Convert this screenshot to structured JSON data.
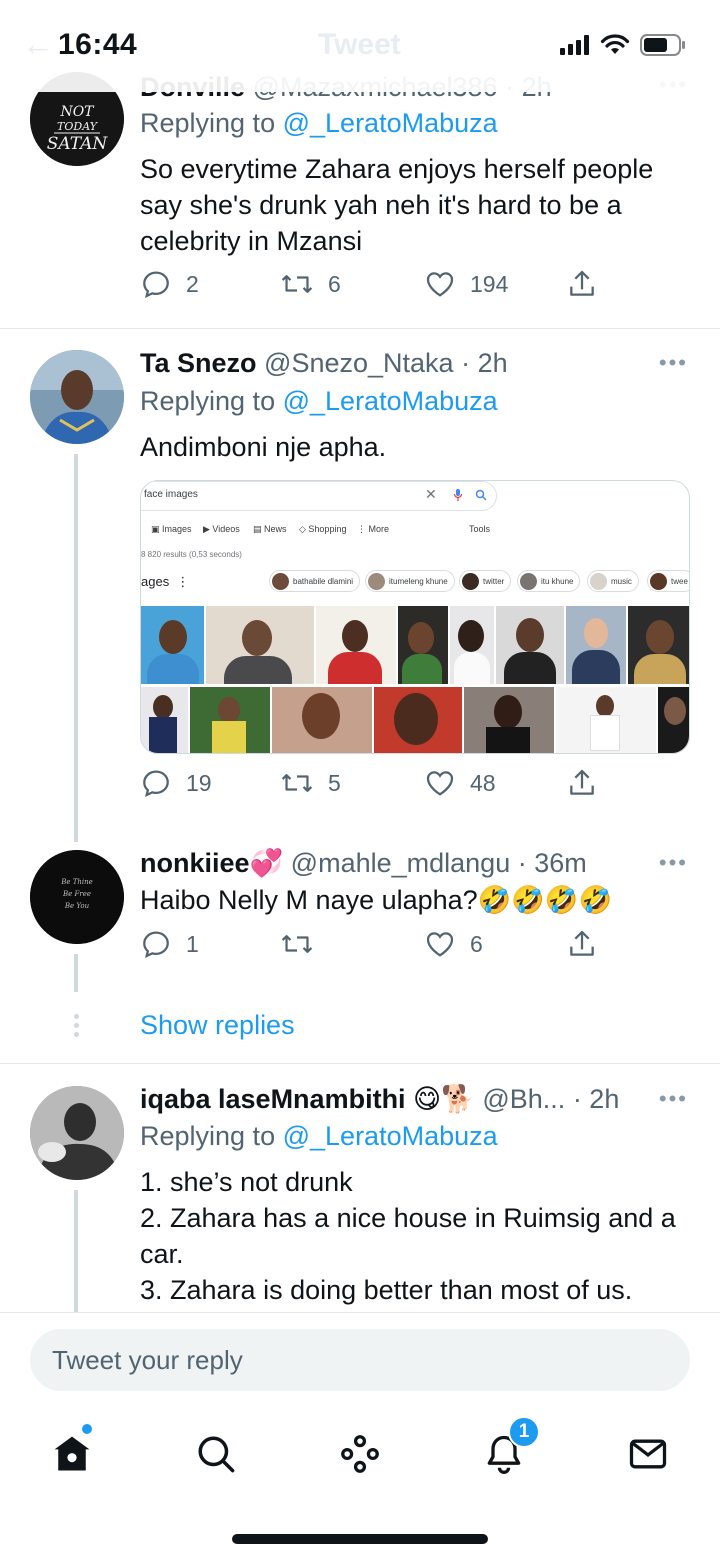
{
  "status": {
    "time": "16:44",
    "ghost_title": "Tweet"
  },
  "tweets": [
    {
      "name": "Donville",
      "handle": "@Mazaxmichael386",
      "time": "· 2h",
      "replying_label": "Replying to",
      "replying_handle": "@_LeratoMabuza",
      "avatar_text": "NOT TODAY SATAN",
      "text": "So everytime Zahara enjoys herself people say she's  drunk yah neh it's hard to be a celebrity in Mzansi",
      "replies": "2",
      "retweets": "6",
      "likes": "194"
    },
    {
      "name": "Ta Snezo",
      "handle": "@Snezo_Ntaka",
      "time": "· 2h",
      "replying_label": "Replying to",
      "replying_handle": "@_LeratoMabuza",
      "text": "Andimboni nje apha.",
      "replies": "19",
      "retweets": "5",
      "likes": "48",
      "media": {
        "query": "face images",
        "tabs": [
          "Images",
          "Videos",
          "News",
          "Shopping",
          "More",
          "Tools"
        ],
        "results_count": "8 820 results (0,53 seconds)",
        "section_label": "ages",
        "chips": [
          "bathabile dlamini",
          "itumeleng khune",
          "twitter",
          "itu khune",
          "music",
          "twee"
        ]
      }
    },
    {
      "name": "nonkiiee💞",
      "handle": "@mahle_mdlangu",
      "time": "· 36m",
      "text": "Haibo Nelly M naye ulapha?🤣🤣🤣🤣",
      "replies": "1",
      "retweets": "",
      "likes": "6"
    },
    {
      "name": "iqaba laseMnambithi 😋🐕",
      "handle": "@Bh...",
      "time": "· 2h",
      "replying_label": "Replying to",
      "replying_handle": "@_LeratoMabuza",
      "text_lines": [
        "1. she’s not drunk",
        "2. Zahara has a nice house in Ruimsig and a car.",
        "3. Zahara is doing better than most of us."
      ]
    }
  ],
  "show_replies": "Show replies",
  "reply_placeholder": "Tweet your reply",
  "tabbar": {
    "items": [
      "home-icon",
      "search-icon",
      "spaces-icon",
      "notifications-icon",
      "messages-icon"
    ],
    "notification_badge": "1"
  },
  "colors": {
    "accent": "#1d9bf0",
    "text": "#0f1419",
    "muted": "#536471"
  }
}
